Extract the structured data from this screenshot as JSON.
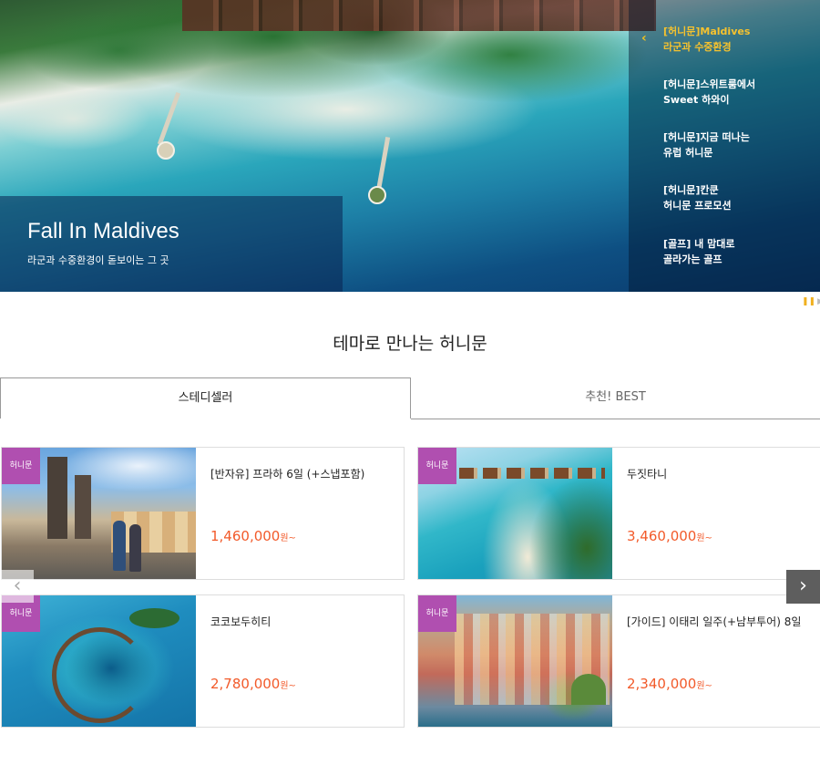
{
  "hero": {
    "caption_title": "Fall In Maldives",
    "caption_sub": "라군과 수중환경이 돋보이는 그 곳",
    "prev_icon": "chevron-left-icon",
    "side_items": [
      {
        "line1": "[허니문]Maldives",
        "line2": "라군과 수중환경",
        "active": true
      },
      {
        "line1": "[허니문]스위트룸에서",
        "line2": "Sweet 하와이",
        "active": false
      },
      {
        "line1": "[허니문]지금 떠나는",
        "line2": "유럽 허니문",
        "active": false
      },
      {
        "line1": "[허니문]칸쿤",
        "line2": "허니문 프로모션",
        "active": false
      },
      {
        "line1": "[골프] 내 맘대로",
        "line2": "골라가는 골프",
        "active": false
      }
    ],
    "pager": {
      "pause_icon": "pause-icon",
      "play_icon": "play-icon"
    }
  },
  "section": {
    "title": "테마로 만나는 허니문"
  },
  "tabs": [
    {
      "label": "스테디셀러",
      "active": true
    },
    {
      "label": "추천! BEST",
      "active": false
    }
  ],
  "cards": [
    {
      "badge": "허니문",
      "title": "[반자유] 프라하 6일 (+스냅포함)",
      "price": "1,460,000",
      "unit": "원~"
    },
    {
      "badge": "허니문",
      "title": "두짓타니",
      "price": "3,460,000",
      "unit": "원~"
    },
    {
      "badge": "허니문",
      "title": "코코보두히티",
      "price": "2,780,000",
      "unit": "원~"
    },
    {
      "badge": "허니문",
      "title": "[가이드] 이태리 일주(+남부투어) 8일",
      "price": "2,340,000",
      "unit": "원~"
    }
  ],
  "carousel": {
    "prev_label": "‹",
    "next_label": "›"
  },
  "colors": {
    "badge": "#b04fb0",
    "price": "#f25a2a",
    "active_side": "#f6c22e"
  }
}
